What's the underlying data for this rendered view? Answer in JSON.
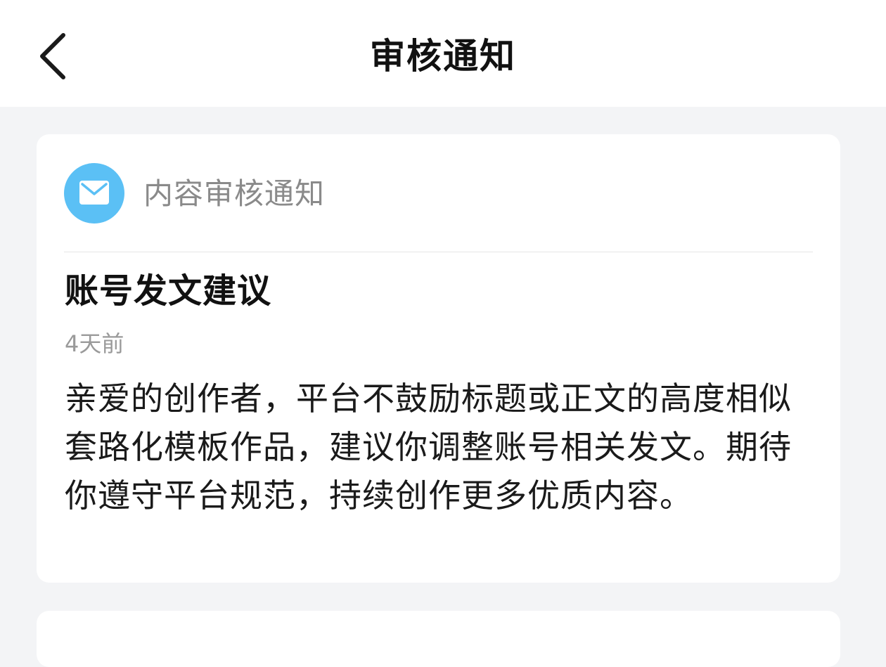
{
  "header": {
    "title": "审核通知"
  },
  "notification": {
    "category": "内容审核通知",
    "title": "账号发文建议",
    "time": "4天前",
    "body": "亲爱的创作者，平台不鼓励标题或正文的高度相似套路化模板作品，建议你调整账号相关发文。期待你遵守平台规范，持续创作更多优质内容。"
  },
  "icons": {
    "back": "chevron-left-icon",
    "category": "mail-icon"
  },
  "colors": {
    "mail_badge": "#5bc0f5",
    "background": "#f3f4f6",
    "card": "#ffffff"
  }
}
